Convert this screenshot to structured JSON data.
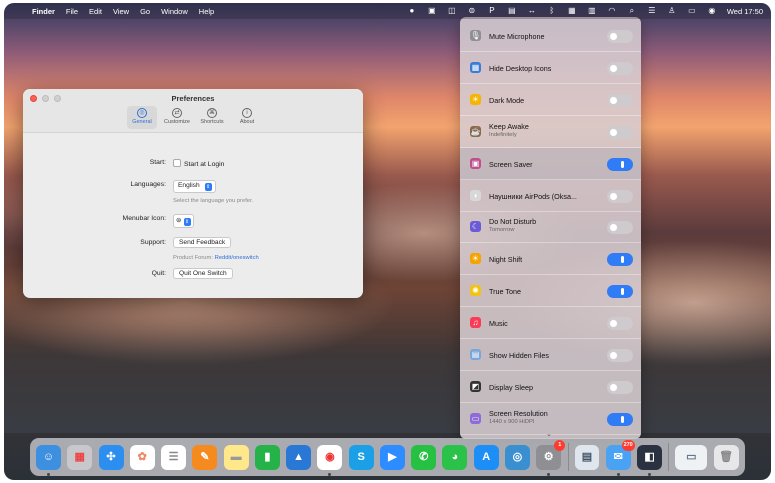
{
  "menubar": {
    "app": "Finder",
    "menus": [
      "File",
      "Edit",
      "View",
      "Go",
      "Window",
      "Help"
    ],
    "clock": "Wed  17:50"
  },
  "prefs": {
    "title": "Preferences",
    "tabs": [
      {
        "label": "General",
        "icon": "gear-icon",
        "active": true
      },
      {
        "label": "Customize",
        "icon": "customize-icon"
      },
      {
        "label": "Shortcuts",
        "icon": "command-icon"
      },
      {
        "label": "About",
        "icon": "info-icon"
      }
    ],
    "start_label": "Start:",
    "start_value": "Start at Login",
    "languages_label": "Languages:",
    "language_value": "English",
    "language_hint": "Select the language you prefer.",
    "menubar_icon_label": "Menubar Icon:",
    "support_label": "Support:",
    "support_button": "Send Feedback",
    "forum_text": "Product Forum:",
    "forum_link": "Reddit/oneswitch",
    "quit_label": "Quit:",
    "quit_button": "Quit One Switch"
  },
  "panel": {
    "items": [
      {
        "title": "Mute Microphone",
        "icon": "microphone-icon",
        "on": false
      },
      {
        "title": "Hide Desktop Icons",
        "icon": "desktop-icons-icon",
        "on": false
      },
      {
        "title": "Dark Mode",
        "icon": "sun-icon",
        "on": false
      },
      {
        "title": "Keep Awake",
        "subtitle": "Indefinitely",
        "icon": "coffee-icon",
        "on": false
      },
      {
        "title": "Screen Saver",
        "icon": "screen-saver-icon",
        "on": true
      },
      {
        "title": "Наушники AirPods (Oksa...",
        "icon": "airpods-icon",
        "on": false
      },
      {
        "title": "Do Not Disturb",
        "subtitle": "Tomorrow",
        "icon": "moon-icon",
        "on": false
      },
      {
        "title": "Night Shift",
        "icon": "night-shift-icon",
        "on": true
      },
      {
        "title": "True Tone",
        "icon": "true-tone-icon",
        "on": true
      },
      {
        "title": "Music",
        "icon": "music-icon",
        "on": false
      },
      {
        "title": "Show Hidden Files",
        "icon": "hidden-files-icon",
        "on": false
      },
      {
        "title": "Display Sleep",
        "icon": "display-sleep-icon",
        "on": false
      },
      {
        "title": "Screen Resolution",
        "subtitle": "1440 x 900 HiDPI",
        "icon": "resolution-icon",
        "on": true
      }
    ]
  },
  "dock": {
    "badges": {
      "app_store": "1",
      "mail": "270"
    }
  }
}
